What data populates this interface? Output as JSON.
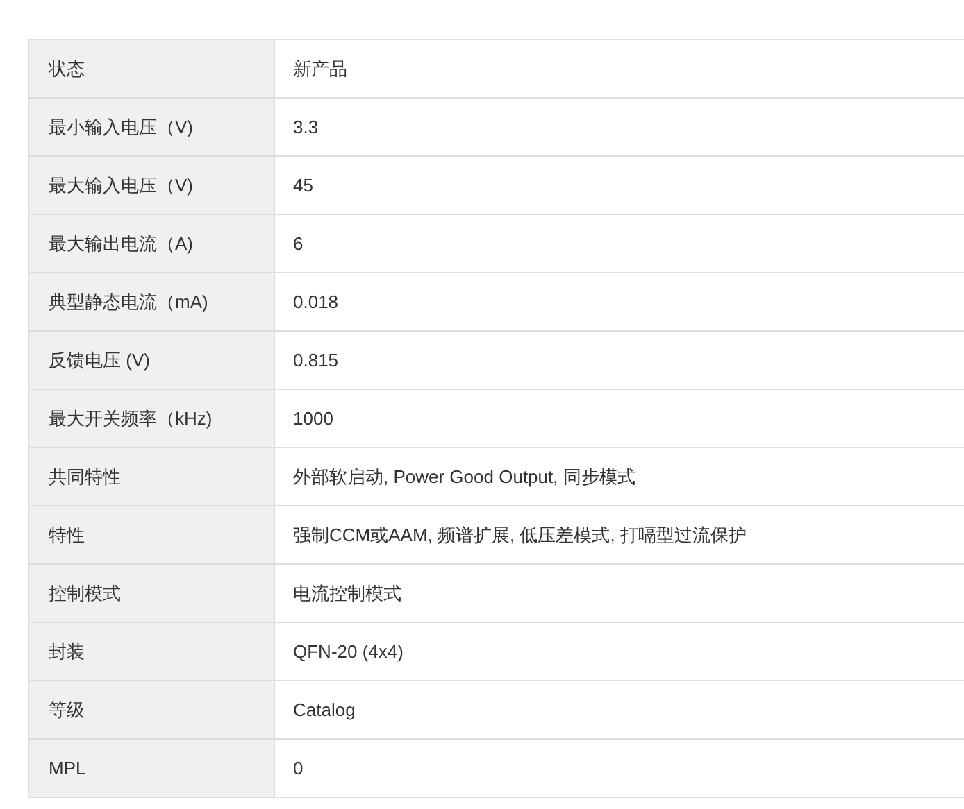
{
  "spec_table": {
    "rows": [
      {
        "label": "状态",
        "value": "新产品"
      },
      {
        "label": "最小输入电压（V)",
        "value": "3.3"
      },
      {
        "label": "最大输入电压（V)",
        "value": "45"
      },
      {
        "label": "最大输出电流（A)",
        "value": "6"
      },
      {
        "label": "典型静态电流（mA)",
        "value": "0.018"
      },
      {
        "label": "反馈电压 (V)",
        "value": "0.815"
      },
      {
        "label": "最大开关频率（kHz)",
        "value": "1000"
      },
      {
        "label": "共同特性",
        "value": "外部软启动, Power Good Output, 同步模式"
      },
      {
        "label": "特性",
        "value": "强制CCM或AAM, 频谱扩展, 低压差模式, 打嗝型过流保护"
      },
      {
        "label": "控制模式",
        "value": "电流控制模式"
      },
      {
        "label": "封装",
        "value": "QFN-20 (4x4)"
      },
      {
        "label": "等级",
        "value": "Catalog"
      },
      {
        "label": "MPL",
        "value": "0"
      }
    ]
  }
}
